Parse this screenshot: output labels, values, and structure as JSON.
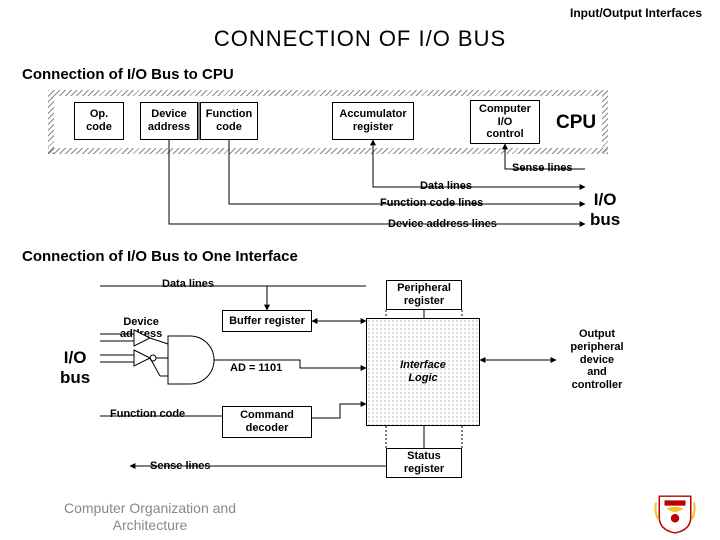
{
  "header": {
    "topic": "Input/Output Interfaces",
    "title": "CONNECTION  OF  I/O  BUS"
  },
  "section1": {
    "heading": "Connection of I/O Bus to CPU",
    "boxes": {
      "op_code": "Op.\ncode",
      "device_address": "Device\naddress",
      "function_code": "Function\ncode",
      "accumulator": "Accumulator\nregister",
      "computer_io_control": "Computer\nI/O\ncontrol"
    },
    "labels": {
      "cpu": "CPU",
      "sense_lines": "Sense lines",
      "data_lines": "Data lines",
      "function_code_lines": "Function code lines",
      "device_address_lines": "Device address lines",
      "io_bus": "I/O\nbus"
    }
  },
  "section2": {
    "heading": "Connection of I/O Bus to One Interface",
    "labels": {
      "data_lines": "Data lines",
      "device_address": "Device\naddress",
      "io_bus": "I/O\nbus",
      "function_code": "Function code",
      "sense_lines": "Sense lines",
      "ad_eq": "AD = 1101"
    },
    "boxes": {
      "buffer_register": "Buffer register",
      "command_decoder": "Command\ndecoder",
      "peripheral_register": "Peripheral\nregister",
      "interface_logic": "Interface\nLogic",
      "status_register": "Status\nregister",
      "output_device": "Output\nperipheral\ndevice\nand\ncontroller"
    }
  },
  "footer": "Computer Organization and Architecture"
}
